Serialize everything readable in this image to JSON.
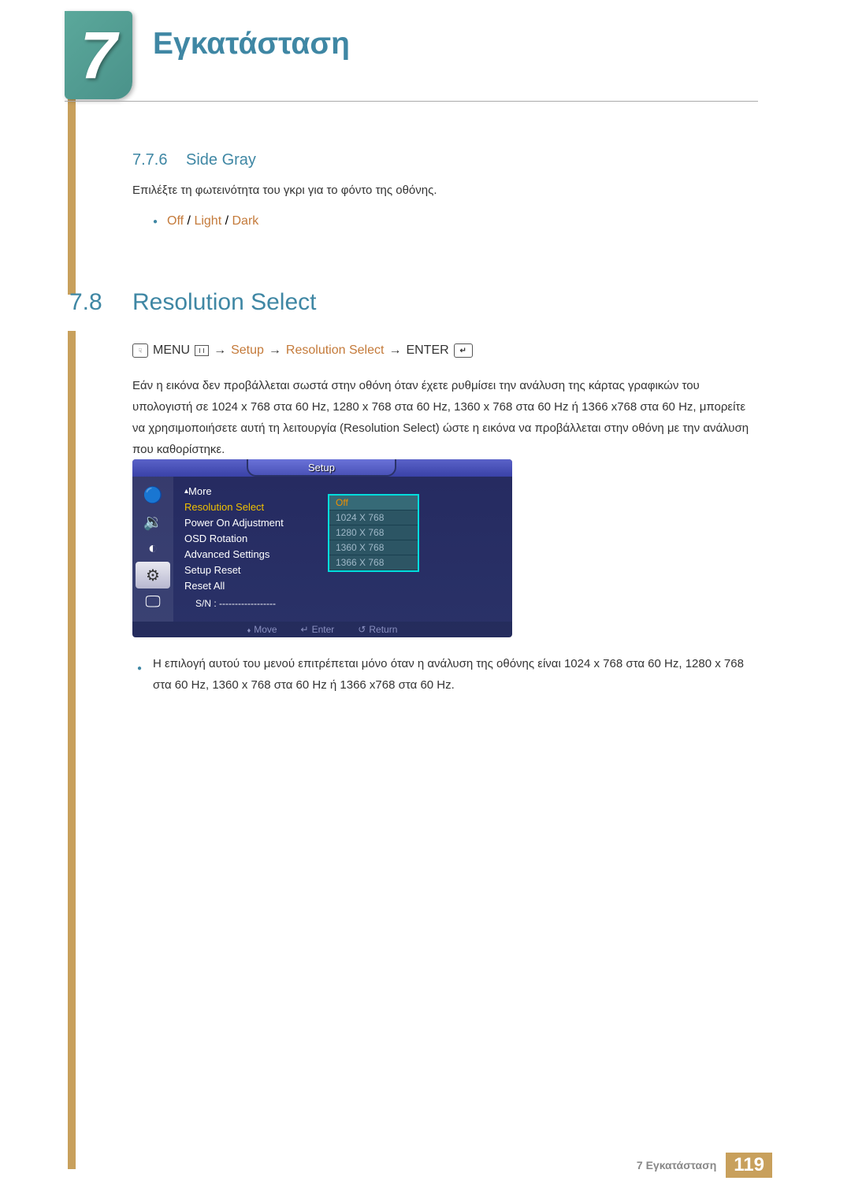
{
  "chapter": {
    "number": "7",
    "title": "Εγκατάσταση"
  },
  "section_776": {
    "number": "7.7.6",
    "title": "Side Gray",
    "description": "Επιλέξτε τη φωτεινότητα του γκρι για το φόντο της οθόνης.",
    "options": {
      "off": "Off",
      "light": "Light",
      "dark": "Dark"
    }
  },
  "section_78": {
    "number": "7.8",
    "title": "Resolution Select",
    "nav": {
      "menu": "MENU",
      "setup": "Setup",
      "resolution_select": "Resolution Select",
      "enter": "ENTER",
      "arrow": "→"
    },
    "paragraph": "Εάν η εικόνα δεν προβάλλεται σωστά στην οθόνη όταν έχετε ρυθμίσει την ανάλυση της κάρτας γραφικών του υπολογιστή σε 1024 x 768 στα 60 Hz, 1280 x 768 στα 60 Hz, 1360 x 768 στα 60 Hz ή 1366 x768 στα 60 Hz, μπορείτε να χρησιμοποιήσετε αυτή τη λειτουργία (Resolution Select) ώστε η εικόνα να προβάλλεται στην οθόνη με την ανάλυση που καθορίστηκε.",
    "note": "Η επιλογή αυτού του μενού επιτρέπεται μόνο όταν η ανάλυση της οθόνης είναι 1024 x 768 στα 60 Hz, 1280 x 768 στα 60 Hz, 1360 x 768 στα 60 Hz ή 1366 x768 στα 60 Hz."
  },
  "osd": {
    "tab": "Setup",
    "more": "More",
    "items": {
      "resolution_select": "Resolution Select",
      "power_on_adjustment": "Power On Adjustment",
      "osd_rotation": "OSD Rotation",
      "advanced_settings": "Advanced Settings",
      "setup_reset": "Setup Reset",
      "reset_all": "Reset All"
    },
    "sn_label": "S/N :",
    "sn_value": "------------------",
    "options": {
      "off": "Off",
      "r1024": "1024 X 768",
      "r1280": "1280 X 768",
      "r1360": "1360 X 768",
      "r1366": "1366 X 768"
    },
    "footer": {
      "move": "Move",
      "enter": "Enter",
      "return": "Return"
    }
  },
  "footer": {
    "label": "7 Εγκατάσταση",
    "page": "119"
  },
  "colors": {
    "accent": "#c47a3a",
    "heading": "#3f87a4",
    "amber": "#c8a05c"
  },
  "separators": {
    "slash": " / "
  }
}
